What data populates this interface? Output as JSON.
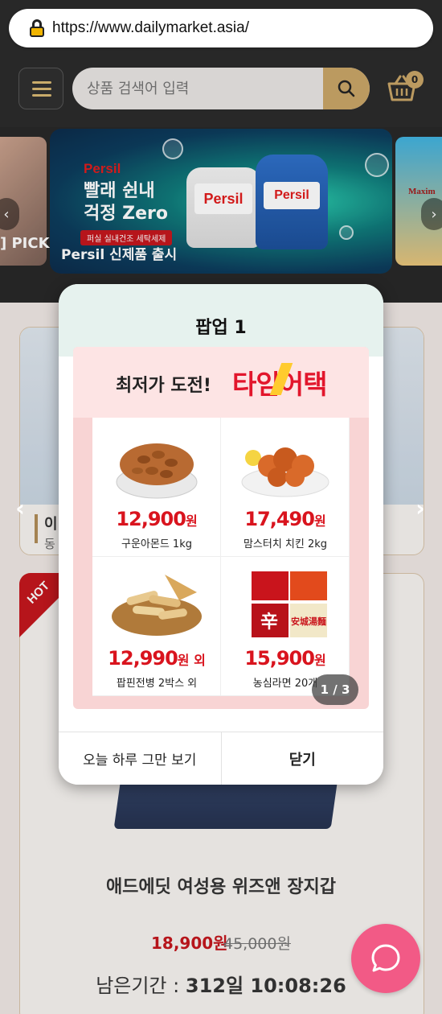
{
  "browser": {
    "url": "https://www.dailymarket.asia/"
  },
  "header": {
    "search_placeholder": "상품 검색어 입력",
    "cart_count": "0"
  },
  "banner": {
    "left_text": "] PICK",
    "brand": "Persil",
    "headline_line1": "빨래 쉰내",
    "headline_line2": "걱정 Zero",
    "tag": "퍼실 실내건조 세탁세제",
    "subtitle": "Persil 신제품 출시",
    "bottle1_label": "Persil",
    "bottle2_label": "Persil",
    "right_brand": "Maxim",
    "prev_arrow": "‹",
    "next_arrow": "›"
  },
  "background_cards": {
    "card1_line1": "이",
    "card1_line2": "동",
    "hot_badge": "HOT",
    "product_name": "애드에딧 여성용 위즈앤 장지갑",
    "sale_price": "18,900원",
    "original_price": "45,000원",
    "remaining_label": "남은기간 :",
    "remaining_value": "312일 10:08:26"
  },
  "popup": {
    "title": "팝업 1",
    "promo_title": "최저가 도전!",
    "promo_highlight": "타임어택",
    "items": [
      {
        "price": "12,900",
        "unit": "원",
        "suffix": "",
        "name": "구운아몬드 1kg",
        "icon": "almond-bowl-icon"
      },
      {
        "price": "17,490",
        "unit": "원",
        "suffix": "",
        "name": "맘스터치 치킨 2kg",
        "icon": "fried-chicken-icon"
      },
      {
        "price": "12,990",
        "unit": "원",
        "suffix": " 외",
        "name": "팝핀전병 2박스 외",
        "icon": "rice-cracker-icon"
      },
      {
        "price": "15,900",
        "unit": "원",
        "suffix": "",
        "name": "농심라면 20개",
        "icon": "ramen-pack-icon"
      }
    ],
    "pager": "1 / 3",
    "prev_arrow": "‹",
    "next_arrow": "›",
    "dismiss_today": "오늘 하루 그만 보기",
    "close": "닫기"
  },
  "colors": {
    "accent_gold": "#c9a567",
    "price_red": "#d9141e",
    "chat_pink": "#f25a86"
  }
}
